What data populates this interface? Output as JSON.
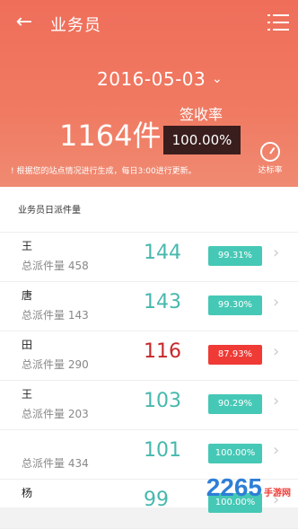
{
  "header": {
    "title": "业务员",
    "date": "2016-05-03",
    "total": "1164件",
    "sign_label": "签收率",
    "sign_rate": "100.00%",
    "gauge_label": "达标率",
    "note": "! 根据您的站点情况进行生成，每日3:00进行更新。"
  },
  "list": {
    "heading": "业务员日派件量",
    "rows": [
      {
        "name": "王",
        "total_label": "总派件量 458",
        "count": "144",
        "rate": "99.31%",
        "status": "ok"
      },
      {
        "name": "唐",
        "total_label": "总派件量 143",
        "count": "143",
        "rate": "99.30%",
        "status": "ok"
      },
      {
        "name": "田",
        "total_label": "总派件量 290",
        "count": "116",
        "rate": "87.93%",
        "status": "warn"
      },
      {
        "name": "王",
        "total_label": "总派件量 203",
        "count": "103",
        "rate": "90.29%",
        "status": "ok"
      },
      {
        "name": "",
        "total_label": "总派件量 434",
        "count": "101",
        "rate": "100.00%",
        "status": "ok"
      },
      {
        "name": "杨",
        "total_label": "",
        "count": "99",
        "rate": "100.00%",
        "status": "ok"
      }
    ]
  },
  "watermark": {
    "text": "2265",
    "suffix": "手游网"
  },
  "colors": {
    "header": "#ef6e5a",
    "ok": "#46c8b6",
    "warn": "#ef3a35"
  }
}
